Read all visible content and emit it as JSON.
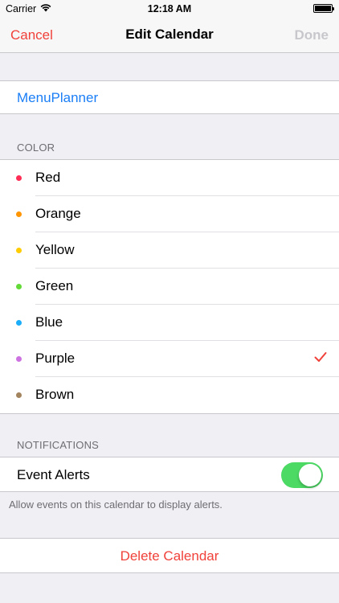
{
  "status_bar": {
    "carrier": "Carrier",
    "time": "12:18 AM",
    "wifi_icon": "wifi-icon",
    "battery_icon": "battery-icon"
  },
  "nav": {
    "cancel_label": "Cancel",
    "title": "Edit Calendar",
    "done_label": "Done"
  },
  "calendar": {
    "name": "MenuPlanner"
  },
  "color_section": {
    "header": "COLOR",
    "selected": "Purple",
    "options": [
      {
        "label": "Red",
        "color": "#ff2d55"
      },
      {
        "label": "Orange",
        "color": "#ff9500"
      },
      {
        "label": "Yellow",
        "color": "#ffcc00"
      },
      {
        "label": "Green",
        "color": "#63da38"
      },
      {
        "label": "Blue",
        "color": "#1badf8"
      },
      {
        "label": "Purple",
        "color": "#cc73e1"
      },
      {
        "label": "Brown",
        "color": "#a2845e"
      }
    ]
  },
  "notifications": {
    "header": "NOTIFICATIONS",
    "event_alerts_label": "Event Alerts",
    "event_alerts_on": true,
    "footer": "Allow events on this calendar to display alerts."
  },
  "delete": {
    "label": "Delete Calendar"
  },
  "colors": {
    "accent_red": "#f0413a",
    "link_blue": "#1a7ef6",
    "toggle_on": "#4cd964"
  }
}
